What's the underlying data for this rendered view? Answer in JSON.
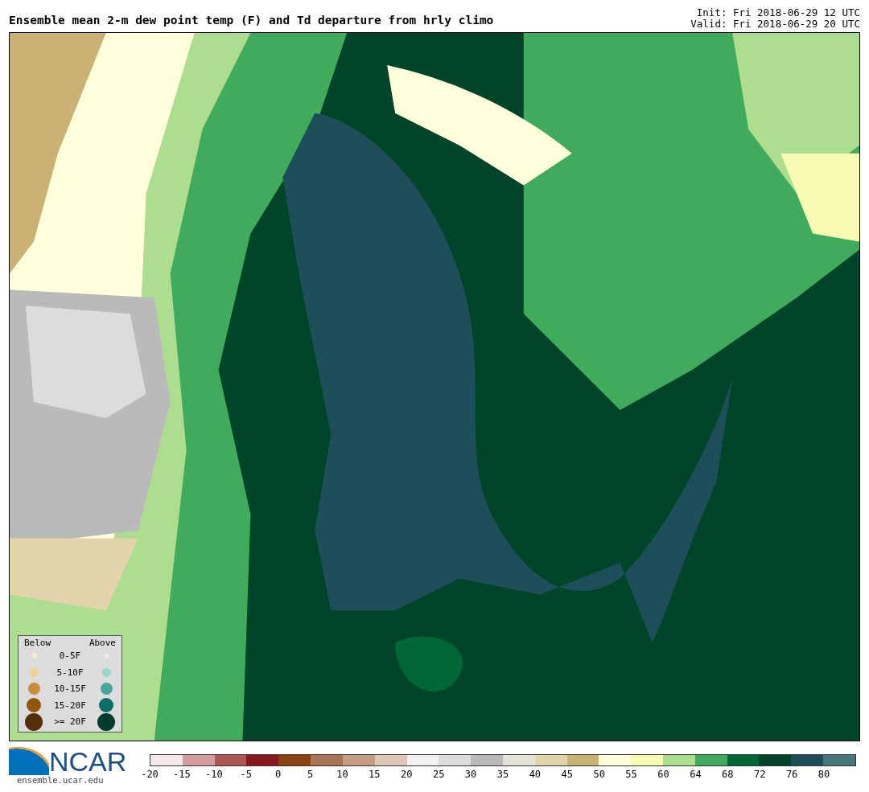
{
  "header": {
    "title": "Ensemble mean 2-m dew point temp (F) and Td departure from hrly climo",
    "init": "Init: Fri 2018-06-29 12 UTC",
    "valid": "Valid: Fri 2018-06-29 20 UTC"
  },
  "legend": {
    "below_label": "Below",
    "above_label": "Above",
    "rows": [
      {
        "label": "0-5F",
        "below": {
          "color": "#f2ead8"
        },
        "above": {
          "color": "#dcefed"
        }
      },
      {
        "label": "5-10F",
        "below": {
          "color": "#ead296"
        },
        "above": {
          "color": "#94d8d0"
        }
      },
      {
        "label": "10-15F",
        "below": {
          "color": "#c68e3e"
        },
        "above": {
          "color": "#45a699"
        }
      },
      {
        "label": "15-20F",
        "below": {
          "color": "#93560e"
        },
        "above": {
          "color": "#0c6e64"
        }
      },
      {
        "label": ">= 20F",
        "below": {
          "color": "#54300a"
        },
        "above": {
          "color": "#013c30"
        }
      }
    ]
  },
  "logo": {
    "text": "NCAR",
    "url": "ensemble.ucar.edu"
  },
  "colorbar": [
    {
      "label": "-20",
      "color": "#f4e8e8"
    },
    {
      "label": "-15",
      "color": "#d49ea0"
    },
    {
      "label": "-10",
      "color": "#ac5656"
    },
    {
      "label": "-5",
      "color": "#8a161e"
    },
    {
      "label": "0",
      "color": "#8b4210"
    },
    {
      "label": "5",
      "color": "#a87655"
    },
    {
      "label": "10",
      "color": "#c59d84"
    },
    {
      "label": "15",
      "color": "#dfc6b6"
    },
    {
      "label": "20",
      "color": "#f1f1f1"
    },
    {
      "label": "25",
      "color": "#dcdcdc"
    },
    {
      "label": "30",
      "color": "#bababa"
    },
    {
      "label": "35",
      "color": "#e4e4d6"
    },
    {
      "label": "40",
      "color": "#e4d4ac"
    },
    {
      "label": "45",
      "color": "#c9b273"
    },
    {
      "label": "50",
      "color": "#ffffdc"
    },
    {
      "label": "55",
      "color": "#f7fbb2"
    },
    {
      "label": "60",
      "color": "#addd8e"
    },
    {
      "label": "64",
      "color": "#41ab5d"
    },
    {
      "label": "68",
      "color": "#006837"
    },
    {
      "label": "72",
      "color": "#004529"
    },
    {
      "label": "76",
      "color": "#1d4e59"
    },
    {
      "label": "80",
      "color": "#47767b"
    }
  ]
}
